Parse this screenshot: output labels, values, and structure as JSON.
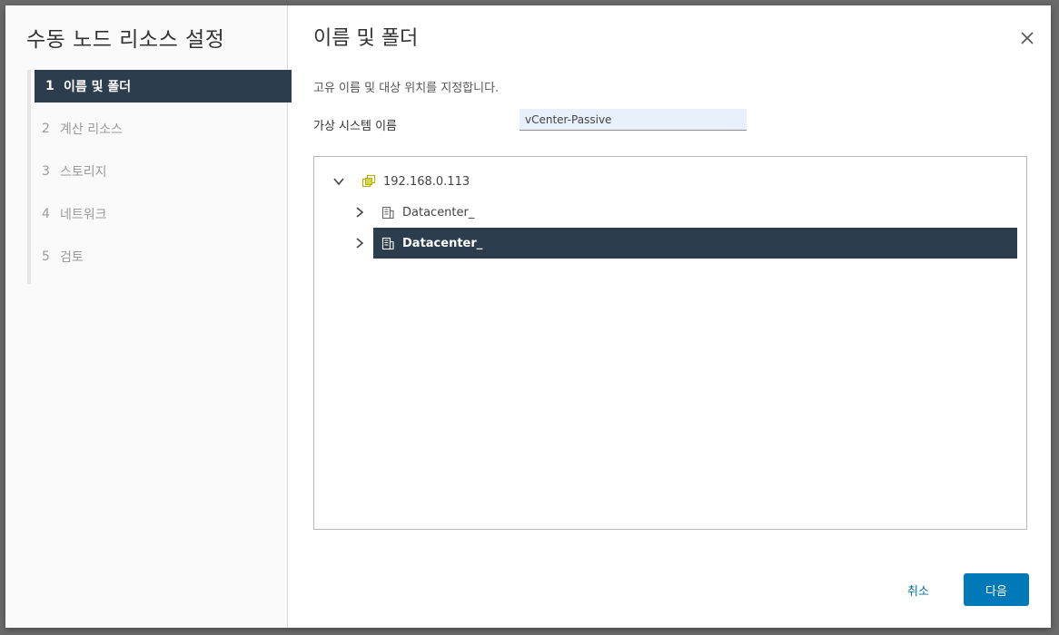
{
  "wizard": {
    "title": "수동 노드 리소스 설정",
    "steps": [
      {
        "num": "1",
        "label": "이름 및 폴더"
      },
      {
        "num": "2",
        "label": "계산 리소스"
      },
      {
        "num": "3",
        "label": "스토리지"
      },
      {
        "num": "4",
        "label": "네트워크"
      },
      {
        "num": "5",
        "label": "검토"
      }
    ]
  },
  "page": {
    "title": "이름 및 폴더",
    "description": "고유 이름 및 대상 위치를 지정합니다.",
    "vm_name_label": "가상 시스템 이름",
    "vm_name_value": "vCenter-Passive"
  },
  "tree": {
    "root": {
      "label": "192.168.0.113",
      "icon": "vcenter-icon"
    },
    "children": [
      {
        "label": "Datacenter_",
        "icon": "datacenter-icon",
        "selected": false
      },
      {
        "label": "Datacenter_",
        "icon": "datacenter-icon",
        "selected": true
      }
    ]
  },
  "footer": {
    "cancel_label": "취소",
    "next_label": "다음"
  },
  "colors": {
    "selected_bg": "#2c3e4e",
    "primary": "#0079b8",
    "link": "#0072a3"
  }
}
